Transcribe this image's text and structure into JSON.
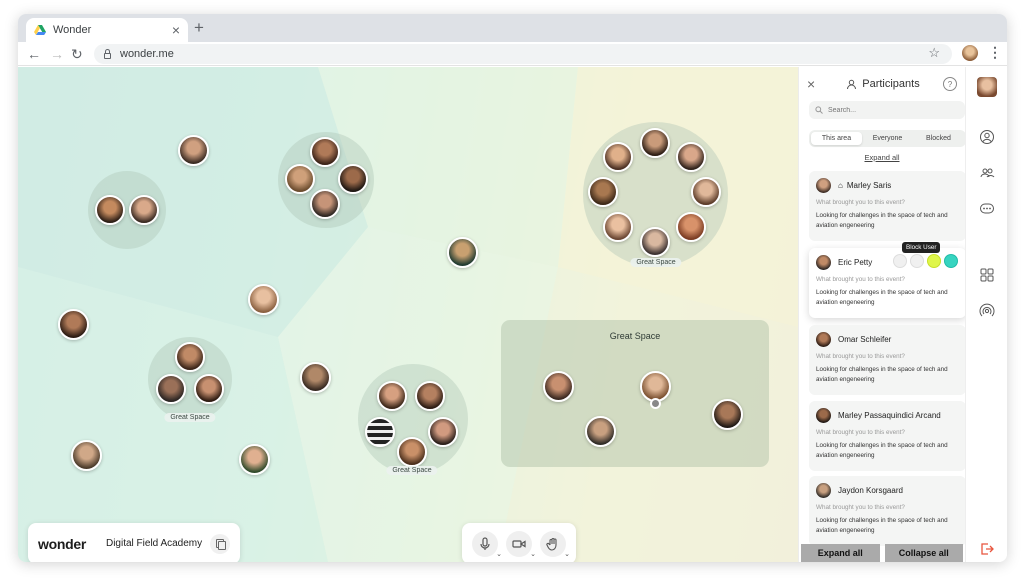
{
  "browser": {
    "tab_title": "Wonder",
    "url": "wonder.me",
    "new_tab": "+",
    "close_glyph": "×"
  },
  "canvas": {
    "space_label": "Great Space",
    "groups": [
      {
        "label": ""
      },
      {
        "label": ""
      },
      {
        "label": "Great Space"
      },
      {
        "label": "Great Space"
      },
      {
        "label": "Great Space"
      }
    ]
  },
  "brand": {
    "logo": "wonder",
    "name": "Digital Field Academy"
  },
  "controls": [
    {
      "icon": "microphone-icon"
    },
    {
      "icon": "camera-icon"
    },
    {
      "icon": "hand-icon"
    }
  ],
  "participants_panel": {
    "title": "Participants",
    "help": "?",
    "search_placeholder": "Search...",
    "filters": [
      "This area",
      "Everyone",
      "Blocked"
    ],
    "active_filter": "This area",
    "expand_link": "Expand all",
    "tooltip": "Block User",
    "participants": [
      {
        "name": "Marley Saris",
        "question": "What brought you to this event?",
        "answer": "Looking for challenges in the space of tech and aviation engeneering",
        "host": true
      },
      {
        "name": "Eric Petty",
        "question": "What brought you to this event?",
        "answer": "Looking for challenges in the space of tech and aviation engeneering",
        "host": false
      },
      {
        "name": "Omar Schleifer",
        "question": "What brought you to this event?",
        "answer": "Looking for challenges in the space of tech and aviation engeneering",
        "host": false
      },
      {
        "name": "Marley Passaquindici Arcand",
        "question": "What brought you to this event?",
        "answer": "Looking for challenges in the space of tech and aviation engeneering",
        "host": false
      },
      {
        "name": "Jaydon Korsgaard",
        "question": "What brought you to this event?",
        "answer": "Looking for challenges in the space of tech and aviation engeneering",
        "host": false
      }
    ],
    "expand_all": "Expand all",
    "collapse_all": "Collapse all"
  },
  "colors": {
    "accent_yellow": "#dff64a",
    "accent_teal": "#37d4c0",
    "leave_red": "#e8553e"
  }
}
